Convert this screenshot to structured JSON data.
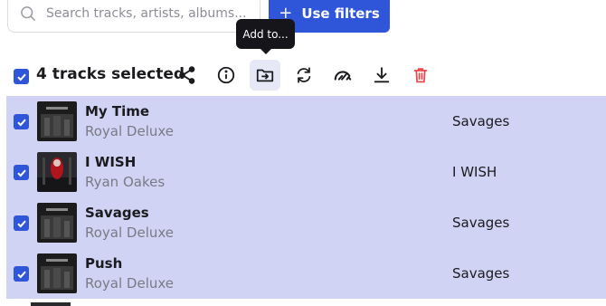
{
  "search": {
    "placeholder": "Search tracks, artists, albums..."
  },
  "filter_button": {
    "label": "Use filters",
    "icon": "plus-icon"
  },
  "tooltip": {
    "text": "Add to..."
  },
  "toolbar": {
    "selected_label": "4 tracks selected",
    "tools": [
      "share-icon",
      "info-icon",
      "add-to-folder-icon",
      "refresh-icon",
      "speedometer-icon",
      "download-icon",
      "trash-icon"
    ]
  },
  "tracks": [
    {
      "title": "My Time",
      "artist": "Royal Deluxe",
      "album": "Savages",
      "cover": "dark"
    },
    {
      "title": "I WISH",
      "artist": "Ryan Oakes",
      "album": "I WISH",
      "cover": "red"
    },
    {
      "title": "Savages",
      "artist": "Royal Deluxe",
      "album": "Savages",
      "cover": "dark"
    },
    {
      "title": "Push",
      "artist": "Royal Deluxe",
      "album": "Savages",
      "cover": "dark"
    }
  ],
  "colors": {
    "accent": "#2f55d9",
    "selected_row": "#d0d3f4",
    "delete": "#e5484d"
  }
}
